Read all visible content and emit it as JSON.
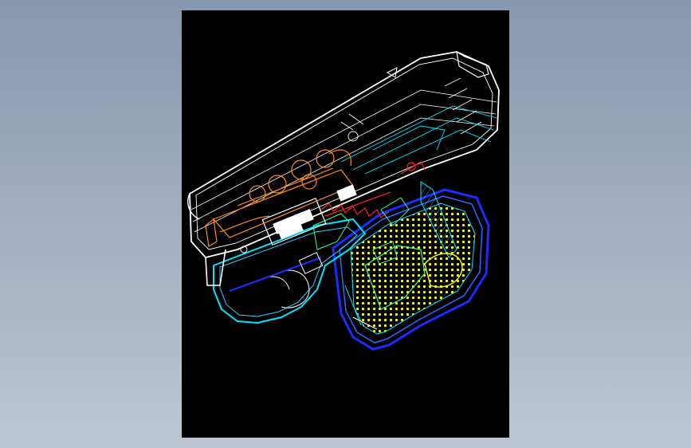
{
  "viewport": {
    "background_top": "#8797ad",
    "background_bottom": "#bcc6d3"
  },
  "drawing": {
    "background": "#000000",
    "model": "pistol-wireframe",
    "layer_colors": {
      "slide": "#ffffff",
      "frame": "#00e5ff",
      "frame_outline": "#1a2cff",
      "internals": "#ff8a1a",
      "grip_texture": "#ffff00",
      "springs": "#ff2020",
      "mid_parts": "#33ff99"
    }
  }
}
